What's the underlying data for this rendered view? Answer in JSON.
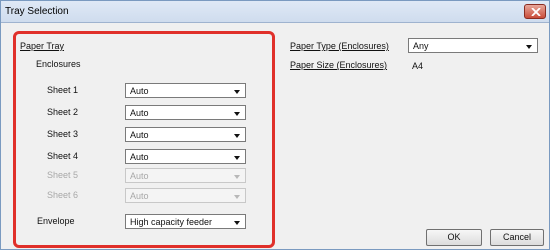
{
  "window": {
    "title": "Tray Selection"
  },
  "highlight_color": "#e0302a",
  "paper_tray": {
    "heading": "Paper Tray",
    "enclosures_heading": "Enclosures",
    "rows": [
      {
        "label": "Sheet 1",
        "value": "Auto",
        "enabled": true
      },
      {
        "label": "Sheet 2",
        "value": "Auto",
        "enabled": true
      },
      {
        "label": "Sheet 3",
        "value": "Auto",
        "enabled": true
      },
      {
        "label": "Sheet 4",
        "value": "Auto",
        "enabled": true
      },
      {
        "label": "Sheet 5",
        "value": "Auto",
        "enabled": false
      },
      {
        "label": "Sheet 6",
        "value": "Auto",
        "enabled": false
      }
    ],
    "envelope": {
      "label": "Envelope",
      "value": "High capacity feeder"
    }
  },
  "paper_type": {
    "label": "Paper Type (Enclosures)",
    "value": "Any"
  },
  "paper_size": {
    "label": "Paper Size (Enclosures)",
    "value": "A4"
  },
  "buttons": {
    "ok": "OK",
    "cancel": "Cancel"
  }
}
